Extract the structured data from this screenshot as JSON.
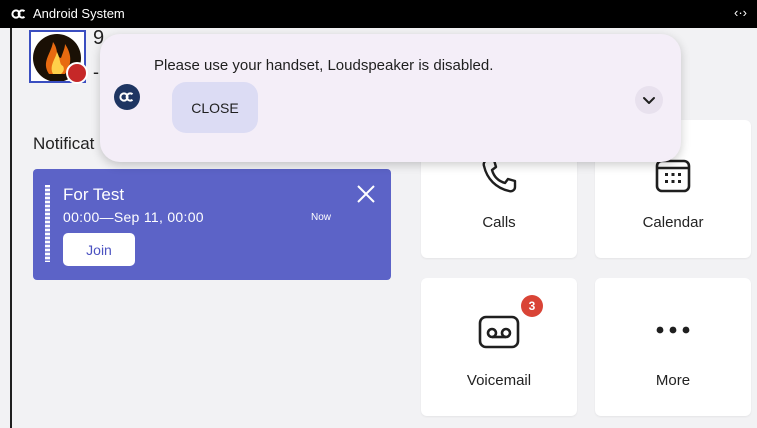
{
  "status_bar": {
    "app_name": "Android System",
    "arrows": "‹·›"
  },
  "user": {
    "name_fragment": "9",
    "line2_fragment": "-"
  },
  "notifications": {
    "heading": "Notificat"
  },
  "meeting": {
    "title": "For Test",
    "time": "00:00—Sep 11, 00:00",
    "status": "Now",
    "join_label": "Join"
  },
  "tiles": {
    "calls": {
      "label": "Calls",
      "icon": "phone-icon"
    },
    "calendar": {
      "label": "Calendar",
      "icon": "calendar-icon"
    },
    "voicemail": {
      "label": "Voicemail",
      "icon": "voicemail-icon",
      "badge": "3"
    },
    "more": {
      "label": "More",
      "icon": "more-dots-icon"
    }
  },
  "alert": {
    "message": "Please use your handset, Loudspeaker is disabled.",
    "close_label": "CLOSE"
  },
  "colors": {
    "accent": "#5c63c7",
    "badge": "#d94436",
    "alert_bg": "#f4eef8",
    "close_button": "#dcdcf4"
  }
}
